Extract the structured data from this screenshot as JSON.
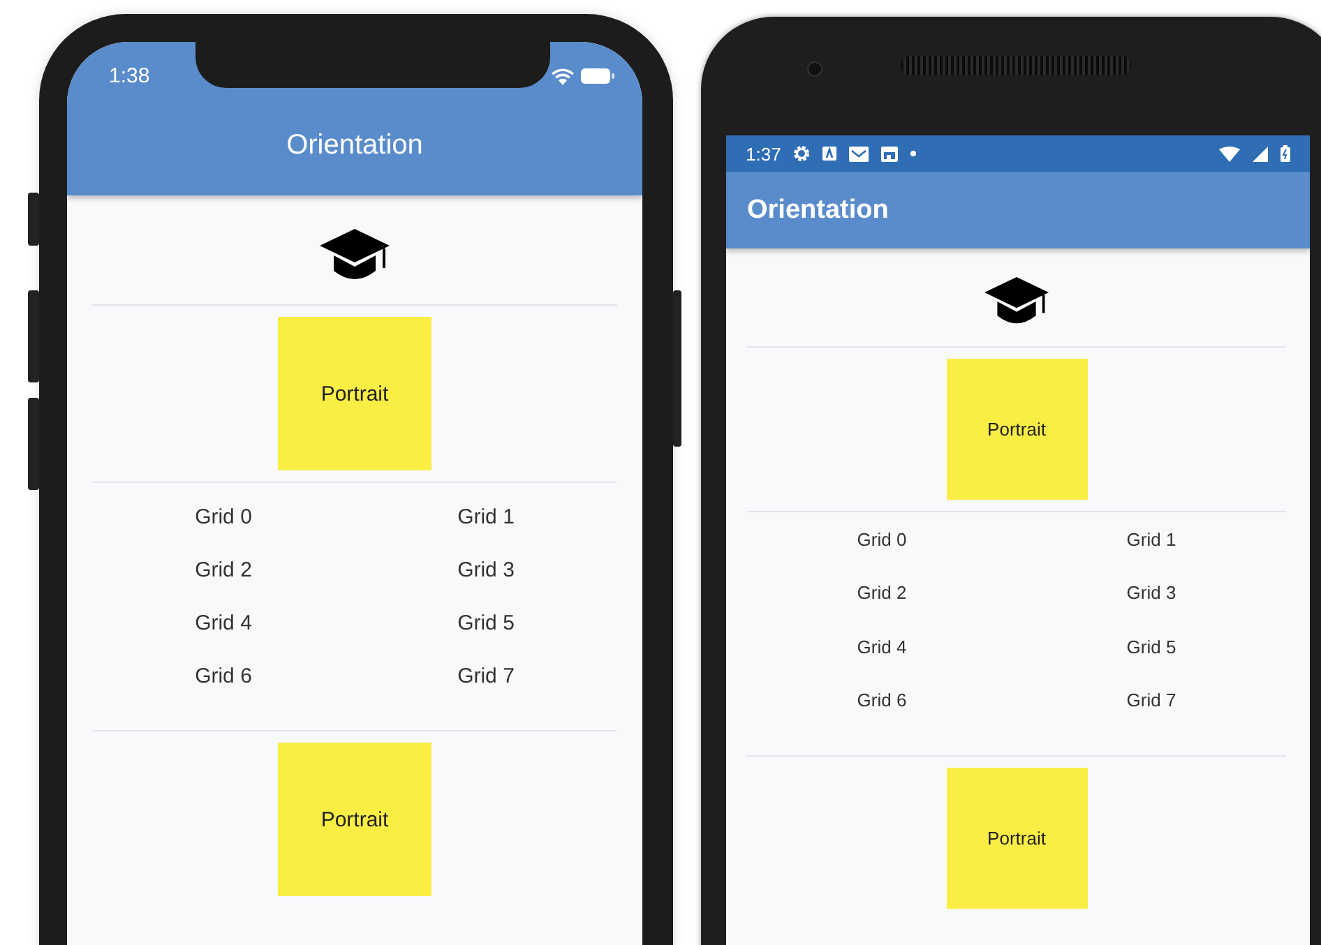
{
  "phones": [
    {
      "kind": "ios",
      "status_bar": {
        "time": "1:38"
      },
      "app_bar": {
        "title": "Orientation"
      },
      "top_box": "Portrait",
      "grid": [
        "Grid 0",
        "Grid 1",
        "Grid 2",
        "Grid 3",
        "Grid 4",
        "Grid 5",
        "Grid 6",
        "Grid 7"
      ],
      "bottom_box": "Portrait"
    },
    {
      "kind": "android",
      "status_bar": {
        "time": "1:37"
      },
      "app_bar": {
        "title": "Orientation"
      },
      "top_box": "Portrait",
      "grid": [
        "Grid 0",
        "Grid 1",
        "Grid 2",
        "Grid 3",
        "Grid 4",
        "Grid 5",
        "Grid 6",
        "Grid 7"
      ],
      "bottom_box": "Portrait"
    }
  ]
}
